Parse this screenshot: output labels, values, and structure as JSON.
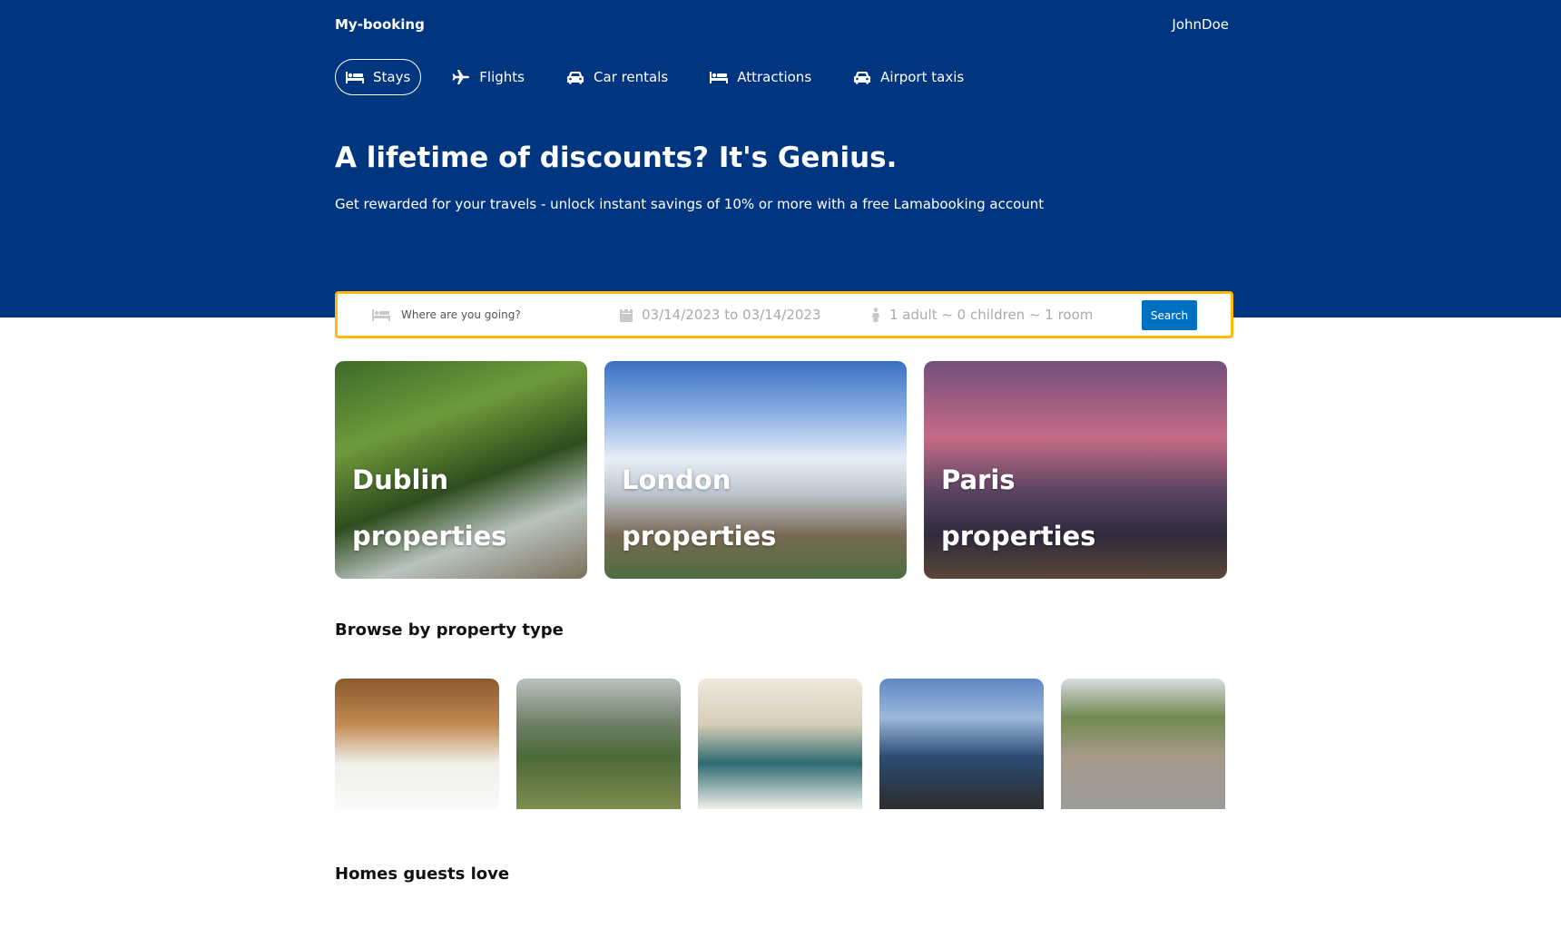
{
  "header": {
    "logo": "My-booking",
    "user": "JohnDoe"
  },
  "nav": {
    "items": [
      {
        "label": "Stays",
        "icon": "bed-icon",
        "active": true
      },
      {
        "label": "Flights",
        "icon": "plane-icon",
        "active": false
      },
      {
        "label": "Car rentals",
        "icon": "car-icon",
        "active": false
      },
      {
        "label": "Attractions",
        "icon": "bed-icon",
        "active": false
      },
      {
        "label": "Airport taxis",
        "icon": "taxi-icon",
        "active": false
      }
    ]
  },
  "hero": {
    "title": "A lifetime of discounts? It's Genius.",
    "description": "Get rewarded for your travels - unlock instant savings of 10% or more with a free Lamabooking account"
  },
  "search": {
    "destination_placeholder": "Where are you going?",
    "dates": "03/14/2023 to 03/14/2023",
    "options": "1 adult ~ 0 children ~ 1 room",
    "button": "Search"
  },
  "featured": [
    {
      "city": "Dublin",
      "label": "properties"
    },
    {
      "city": "London",
      "label": "properties"
    },
    {
      "city": "Paris",
      "label": "properties"
    }
  ],
  "browse": {
    "title": "Browse by property type"
  },
  "homes": {
    "title": "Homes guests love"
  },
  "colors": {
    "brand": "#003580",
    "accent": "#febb02",
    "button": "#0071c2"
  }
}
